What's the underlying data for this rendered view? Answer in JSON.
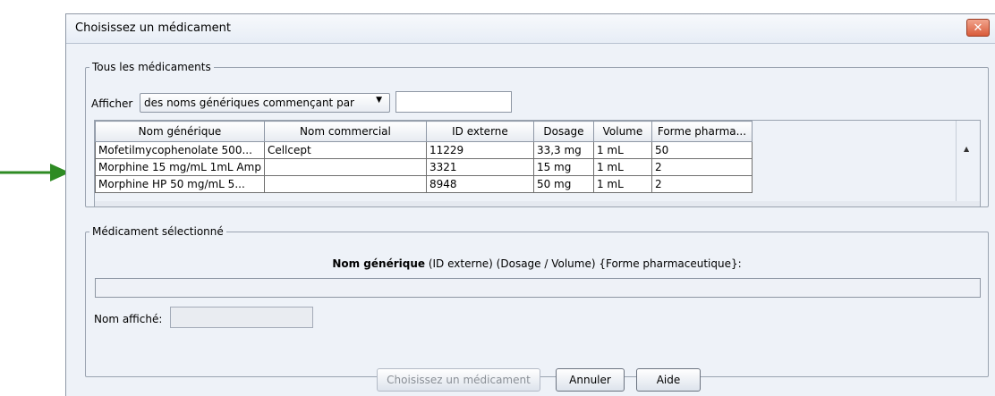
{
  "dialog": {
    "title": "Choisissez un médicament",
    "close_glyph": "✕"
  },
  "all_meds": {
    "legend": "Tous les médicaments",
    "filter_label": "Afficher",
    "filter_selected": "des noms génériques commençant par",
    "filter_value": ""
  },
  "table": {
    "headers": [
      "Nom générique",
      "Nom commercial",
      "ID externe",
      "Dosage",
      "Volume",
      "Forme pharma..."
    ],
    "rows": [
      [
        "Mofetilmycophenolate 500...",
        "Cellcept",
        "11229",
        "33,3 mg",
        "1 mL",
        "50"
      ],
      [
        "Morphine 15 mg/mL  1mL Amp",
        "",
        "3321",
        "15 mg",
        "1 mL",
        "2"
      ],
      [
        "Morphine HP  50 mg/mL  5...",
        "",
        "8948",
        "50 mg",
        "1 mL",
        "2"
      ]
    ]
  },
  "selected": {
    "legend": "Médicament sélectionné",
    "caption_bold": "Nom générique",
    "caption_rest": " (ID externe) (Dosage / Volume) {Forme pharmaceutique}:",
    "generic_value": "",
    "display_label": "Nom affiché:",
    "display_value": ""
  },
  "buttons": {
    "choose": "Choisissez un médicament",
    "cancel": "Annuler",
    "help": "Aide"
  },
  "colors": {
    "arrow": "#2e8b23",
    "dialog_bg": "#eef2f8",
    "close_btn": "#d95b3a"
  }
}
